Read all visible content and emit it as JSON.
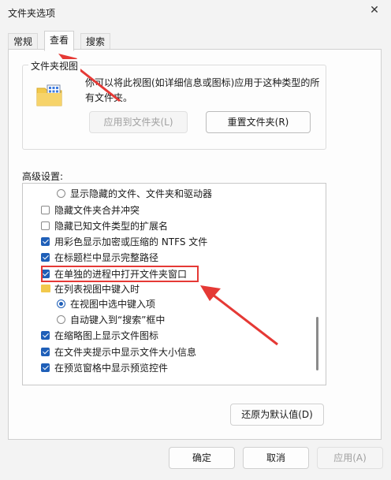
{
  "window": {
    "title": "文件夹选项"
  },
  "tabs": [
    {
      "label": "常规",
      "active": false
    },
    {
      "label": "查看",
      "active": true
    },
    {
      "label": "搜索",
      "active": false
    }
  ],
  "folder_views": {
    "group_label": "文件夹视图",
    "description": "你可以将此视图(如详细信息或图标)应用于这种类型的所有文件夹。",
    "apply_button": "应用到文件夹(L)",
    "reset_button": "重置文件夹(R)"
  },
  "advanced": {
    "label": "高级设置:",
    "items": [
      {
        "kind": "radio",
        "checked": false,
        "label": "显示隐藏的文件、文件夹和驱动器",
        "indent": 2
      },
      {
        "kind": "checkbox",
        "checked": false,
        "label": "隐藏文件夹合并冲突",
        "indent": 1
      },
      {
        "kind": "checkbox",
        "checked": false,
        "label": "隐藏已知文件类型的扩展名",
        "indent": 1
      },
      {
        "kind": "checkbox",
        "checked": true,
        "label": "用彩色显示加密或压缩的 NTFS 文件",
        "indent": 1
      },
      {
        "kind": "checkbox",
        "checked": true,
        "label": "在标题栏中显示完整路径",
        "indent": 1
      },
      {
        "kind": "checkbox",
        "checked": true,
        "label": "在单独的进程中打开文件夹窗口",
        "indent": 1
      },
      {
        "kind": "folder",
        "checked": false,
        "label": "在列表视图中键入时",
        "indent": 1
      },
      {
        "kind": "radio",
        "checked": true,
        "label": "在视图中选中键入项",
        "indent": 2
      },
      {
        "kind": "radio",
        "checked": false,
        "label": "自动键入到“搜索”框中",
        "indent": 2
      },
      {
        "kind": "checkbox",
        "checked": true,
        "label": "在缩略图上显示文件图标",
        "indent": 1
      },
      {
        "kind": "checkbox",
        "checked": true,
        "label": "在文件夹提示中显示文件大小信息",
        "indent": 1
      },
      {
        "kind": "checkbox",
        "checked": true,
        "label": "在预览窗格中显示预览控件",
        "indent": 1
      }
    ],
    "restore_button": "还原为默认值(D)"
  },
  "footer": {
    "ok": "确定",
    "cancel": "取消",
    "apply": "应用(A)"
  },
  "colors": {
    "accent": "#1f5fb8",
    "annotation": "#e53935",
    "folder": "#f2c94c"
  }
}
